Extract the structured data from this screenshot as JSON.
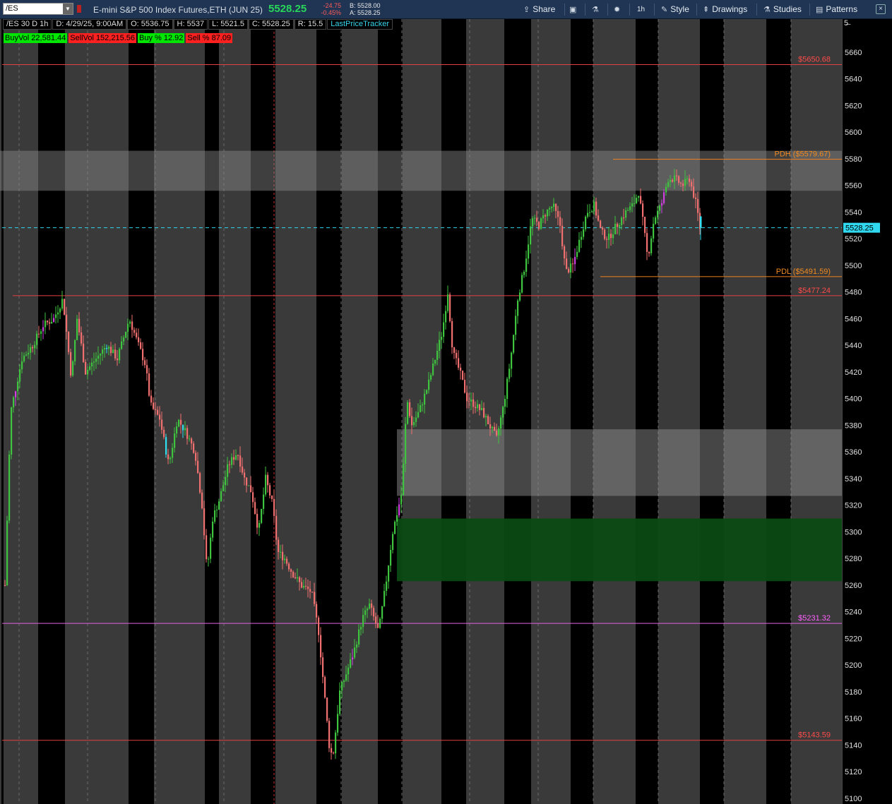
{
  "toolbar": {
    "symbol": "/ES",
    "description": "E-mini S&P 500 Index Futures,ETH (JUN 25)",
    "last": "5528.25",
    "change": "-24.75",
    "change_pct": "-0.45%",
    "bid": "B: 5528.00",
    "ask": "A: 5528.25",
    "share": "Share",
    "interval": "1h",
    "style": "Style",
    "drawings": "Drawings",
    "studies": "Studies",
    "patterns": "Patterns"
  },
  "info_bar": {
    "chart_label": "/ES 30 D 1h",
    "date": "D: 4/29/25, 9:00AM",
    "open": "O: 5536.75",
    "high": "H: 5537",
    "low": "L: 5521.5",
    "close": "C: 5528.25",
    "range": "R: 15.5",
    "tracker": "LastPriceTracker"
  },
  "stats": [
    {
      "label": "BuyVol 22,581.44",
      "color": "#00e600"
    },
    {
      "label": "SellVol 152,215.56",
      "color": "#ff2020"
    },
    {
      "label": "Buy % 12.92",
      "color": "#00e600"
    },
    {
      "label": "Sell % 87.09",
      "color": "#ff2020"
    }
  ],
  "axis_header": "5̶"
}
